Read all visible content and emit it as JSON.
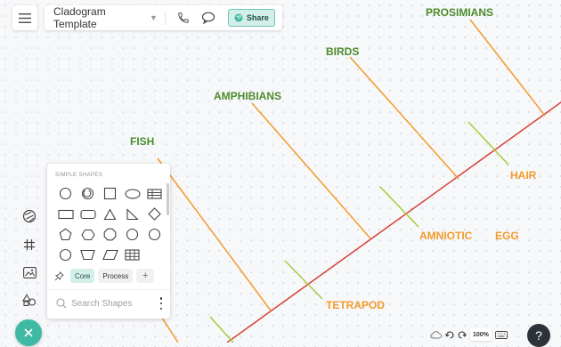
{
  "toolbar": {
    "doc_title": "Cladogram Template",
    "share_label": "Share"
  },
  "diagram": {
    "labels": {
      "prosimians": "PROSIMIANS",
      "birds": "BIRDS",
      "amphibians": "AMPHIBIANS",
      "fish": "FISH",
      "hair": "HAIR",
      "amniotic": "AMNIOTIC",
      "egg": "EGG",
      "tetrapod": "TETRAPOD"
    },
    "colors": {
      "taxon_text": "#4c8b2b",
      "trait_text": "#f39a2a",
      "branch": "#f39a2a",
      "main_line": "#d64035",
      "trait_marker": "#a6cc3a"
    }
  },
  "shapes_panel": {
    "title": "SIMPLE SHAPES",
    "tabs": [
      "Core",
      "Process",
      "+"
    ],
    "search_placeholder": "Search Shapes"
  },
  "status": {
    "zoom": "100%",
    "help": "?"
  },
  "icons": [
    "menu-icon",
    "chevron-down-icon",
    "phone-icon",
    "comment-icon",
    "globe-icon",
    "palette-icon",
    "grid-icon",
    "image-icon",
    "shapes-icon",
    "close-icon",
    "pin-icon",
    "search-icon",
    "more-icon",
    "cloud-icon",
    "undo-icon",
    "redo-icon",
    "keyboard-icon",
    "help-icon"
  ]
}
